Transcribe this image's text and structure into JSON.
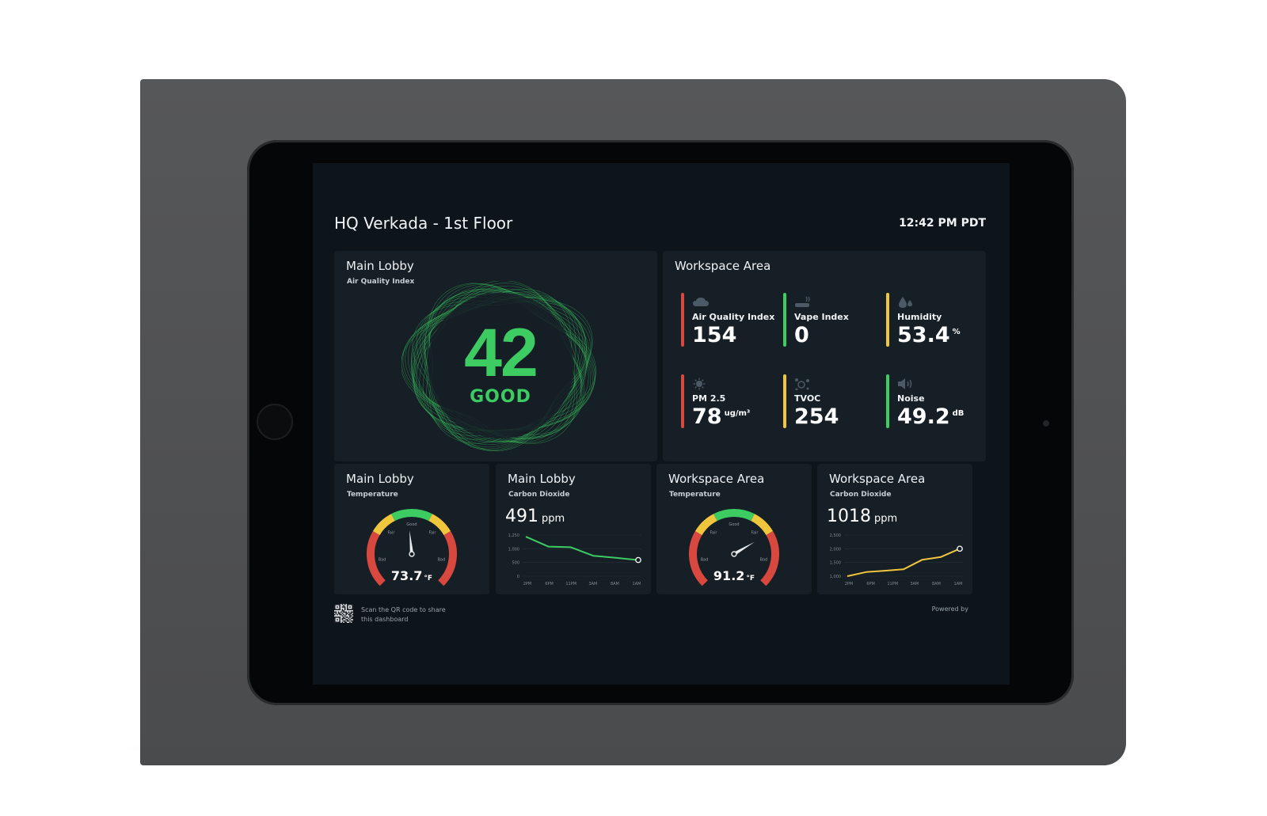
{
  "dashboard": {
    "title": "HQ Verkada - 1st Floor",
    "time": "12:42 PM PDT"
  },
  "aqi_card": {
    "title": "Main Lobby",
    "subtitle": "Air Quality Index",
    "value": "42",
    "status": "GOOD",
    "color": "#3ccc62"
  },
  "workspace": {
    "title": "Workspace  Area",
    "metrics": [
      {
        "label": "Air Quality Index",
        "value": "154",
        "unit": "",
        "color": "#d9483f",
        "icon": "cloud-icon"
      },
      {
        "label": "Vape Index",
        "value": "0",
        "unit": "",
        "color": "#3ccc62",
        "icon": "vape-icon"
      },
      {
        "label": "Humidity",
        "value": "53.4",
        "unit": "%",
        "color": "#f0c63c",
        "icon": "droplet-icon"
      },
      {
        "label": "PM 2.5",
        "value": "78",
        "unit": "ug/m³",
        "color": "#d9483f",
        "icon": "particles-icon"
      },
      {
        "label": "TVOC",
        "value": "254",
        "unit": "",
        "color": "#f0c63c",
        "icon": "molecule-icon"
      },
      {
        "label": "Noise",
        "value": "49.2",
        "unit": "dB",
        "color": "#3ccc62",
        "icon": "speaker-icon"
      }
    ]
  },
  "gauge_labels": {
    "good": "Good",
    "fair": "Fair",
    "bad": "Bad"
  },
  "cards": [
    {
      "title": "Main Lobby",
      "subtitle": "Temperature",
      "reading": "73.7",
      "unit": "°F",
      "needle_fraction": 0.48
    },
    {
      "title": "Main Lobby",
      "subtitle": "Carbon Dioxide",
      "reading": "491",
      "unit": "ppm"
    },
    {
      "title": "Workspace Area",
      "subtitle": "Temperature",
      "reading": "91.2",
      "unit": "°F",
      "needle_fraction": 0.72
    },
    {
      "title": "Workspace Area",
      "subtitle": "Carbon Dioxide",
      "reading": "1018",
      "unit": "ppm"
    }
  ],
  "chart_data": [
    {
      "type": "line",
      "x": [
        "2PM",
        "6PM",
        "11PM",
        "3AM",
        "8AM",
        "1AM"
      ],
      "series": [
        {
          "values": [
            1200,
            900,
            880,
            620,
            560,
            491
          ],
          "color": "#3ccc62"
        }
      ],
      "y_ticks": [
        "1,250",
        "1,000",
        "500",
        "0"
      ],
      "ylim": [
        0,
        1250
      ],
      "grid": true
    },
    {
      "type": "line",
      "x": [
        "2PM",
        "6PM",
        "11PM",
        "3AM",
        "8AM",
        "1AM"
      ],
      "series": [
        {
          "values": [
            1000,
            1150,
            1200,
            1250,
            1600,
            1700,
            2000
          ],
          "color": "#f0c63c"
        }
      ],
      "y_ticks": [
        "2,500",
        "2,000",
        "1,500",
        "1,000"
      ],
      "ylim": [
        1000,
        2500
      ],
      "grid": true
    }
  ],
  "footer": {
    "qr_text": "Scan the QR code to share this dashboard",
    "powered": "Powered by"
  }
}
